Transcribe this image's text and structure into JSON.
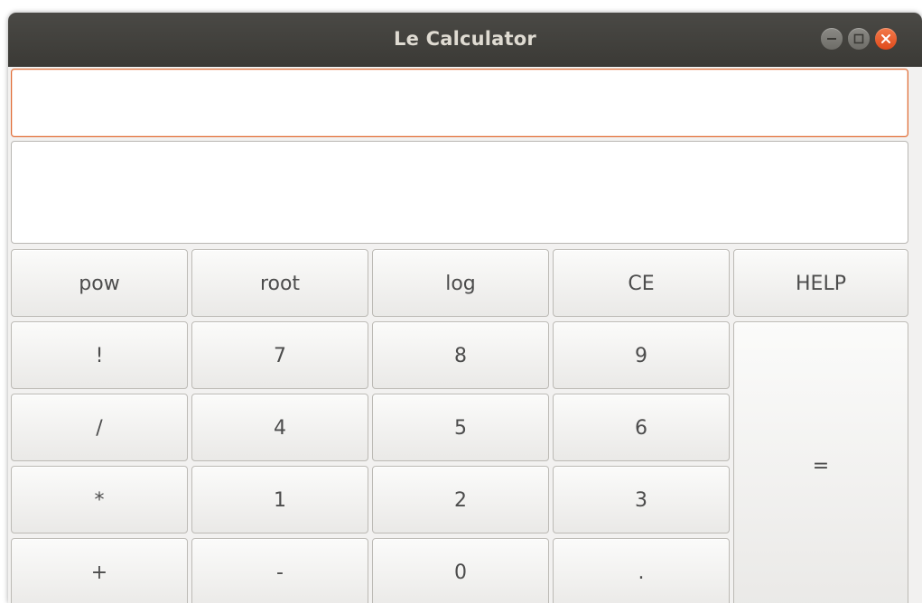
{
  "window": {
    "title": "Le Calculator",
    "controls": [
      "minimize-icon",
      "maximize-icon",
      "close-icon"
    ],
    "accent_color": "#e95420"
  },
  "display": {
    "input_value": "",
    "result_value": ""
  },
  "keys": {
    "pow": "pow",
    "root": "root",
    "log": "log",
    "ce": "CE",
    "help": "HELP",
    "factorial": "!",
    "seven": "7",
    "eight": "8",
    "nine": "9",
    "divide": "/",
    "four": "4",
    "five": "5",
    "six": "6",
    "multiply": "*",
    "one": "1",
    "two": "2",
    "three": "3",
    "plus": "+",
    "minus": "-",
    "zero": "0",
    "decimal": ".",
    "equals": "="
  }
}
